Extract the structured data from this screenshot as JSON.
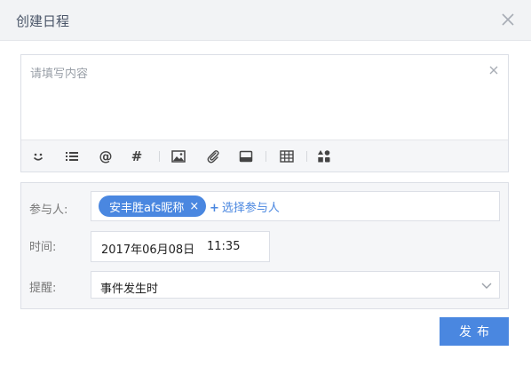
{
  "dialog": {
    "title": "创建日程"
  },
  "editor": {
    "placeholder": "请填写内容",
    "toolbar": [
      "emoji-icon",
      "list-icon",
      "mention-icon",
      "hashtag-icon",
      "image-icon",
      "attachment-icon",
      "tray-icon",
      "table-icon",
      "apps-icon"
    ],
    "toolbar_text": {
      "at": "@",
      "hash": "#"
    }
  },
  "form": {
    "participants_label": "参与人:",
    "participant_chip": "安丰胜afs昵称",
    "chip_remove": "×",
    "add_participant": "选择参与人",
    "add_plus": "+",
    "time_label": "时间:",
    "date_value": "2017年06月08日",
    "time_value": "11:35",
    "reminder_label": "提醒:",
    "reminder_value": "事件发生时"
  },
  "actions": {
    "publish_label": "发布"
  },
  "colors": {
    "accent": "#4a87e0",
    "header_bg": "#f2f3f5",
    "panel_bg": "#f5f6f8"
  }
}
